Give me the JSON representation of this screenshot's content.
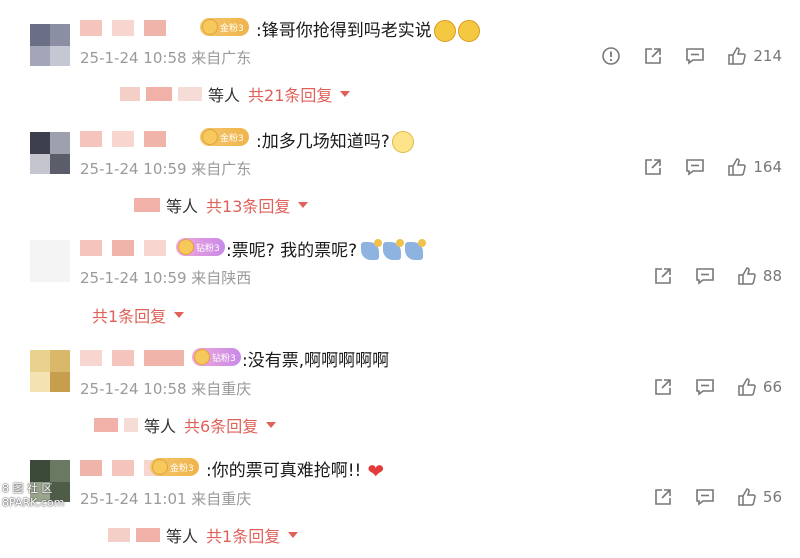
{
  "comments": [
    {
      "badge": "金粉3",
      "text": ":锋哥你抢得到吗老实说",
      "meta": "25-1-24 10:58 来自广东",
      "like_count": "214",
      "reply_who": "等人",
      "reply_more": "共21条回复"
    },
    {
      "badge": "金粉3",
      "text": ":加多几场知道吗?",
      "meta": "25-1-24 10:59 来自广东",
      "like_count": "164",
      "reply_who": "等人",
      "reply_more": "共13条回复"
    },
    {
      "badge": "钻粉3",
      "text": ":票呢? 我的票呢?",
      "meta": "25-1-24 10:59 来自陕西",
      "like_count": "88",
      "reply_who": "",
      "reply_more": "共1条回复"
    },
    {
      "badge": "钻粉3",
      "text": ":没有票,啊啊啊啊啊",
      "meta": "25-1-24 10:58 来自重庆",
      "like_count": "66",
      "reply_who": "等人",
      "reply_more": "共6条回复"
    },
    {
      "badge": "金粉3",
      "text": ":你的票可真难抢啊!!",
      "meta": "25-1-24 11:01 来自重庆",
      "like_count": "56",
      "reply_who": "等人",
      "reply_more": "共1条回复"
    }
  ],
  "watermark": {
    "line1": "8 图 社 区",
    "line2": "8PARK.com"
  },
  "icons": {
    "report": "report-icon",
    "share": "share-icon",
    "comment": "comment-icon",
    "like": "like-icon"
  },
  "colors": {
    "accent": "#e0615a",
    "meta": "#9a9a9a",
    "heart": "#e23b3b"
  }
}
